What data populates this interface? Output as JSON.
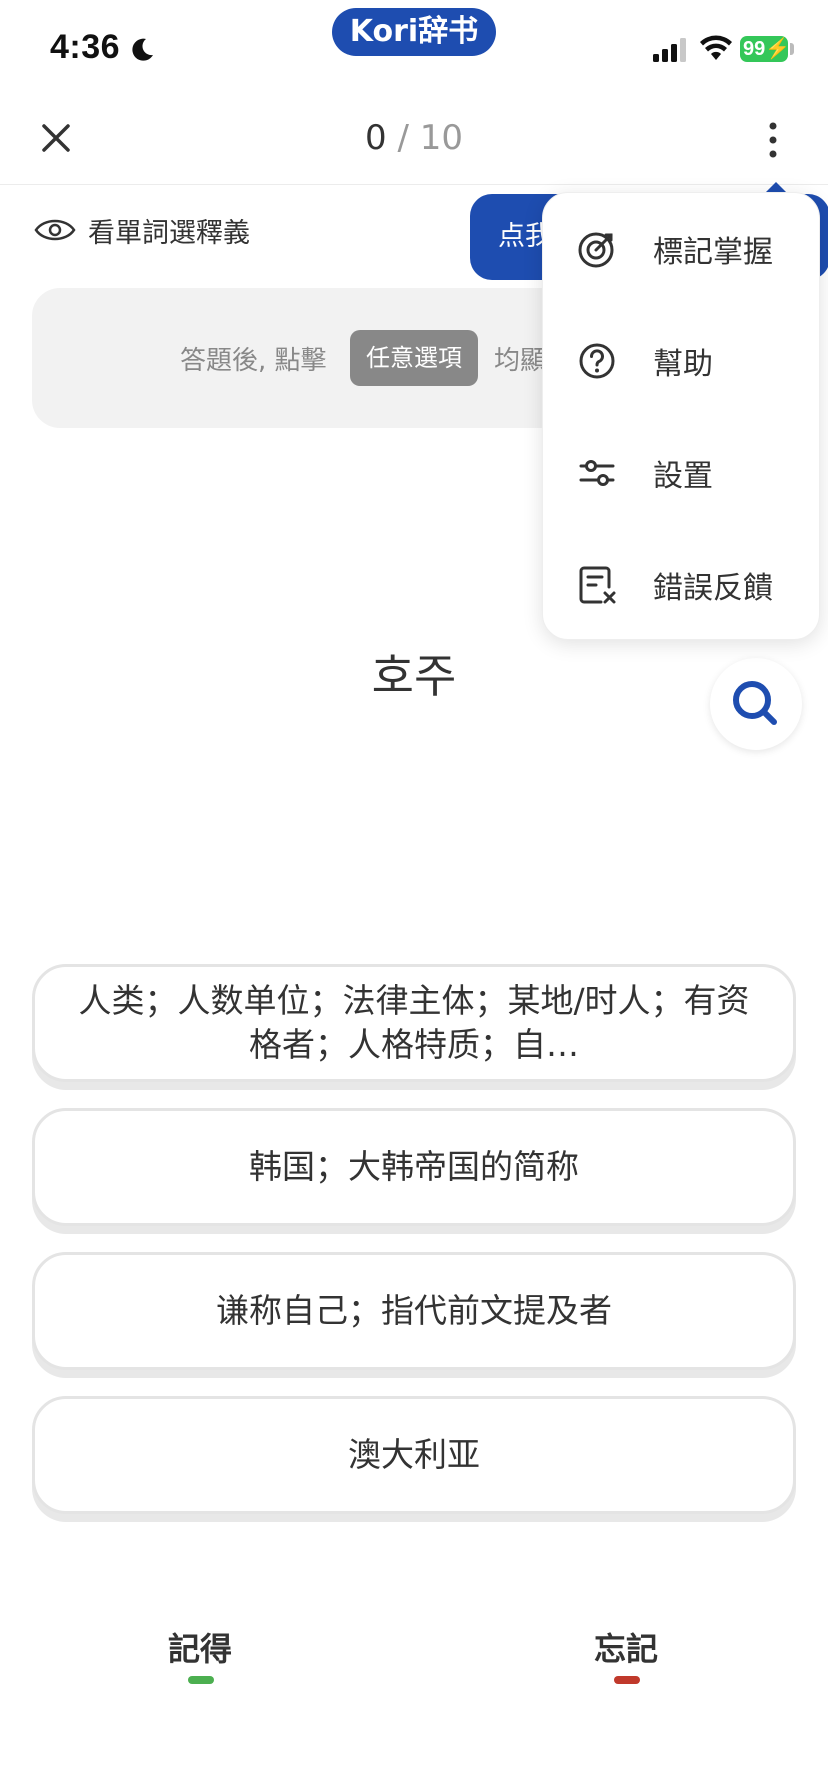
{
  "status_bar": {
    "time": "4:36",
    "brand": "Kori辞书",
    "battery": "99"
  },
  "topbar": {
    "progress_current": "0",
    "progress_total": "10",
    "progress_sep": " / "
  },
  "toggle": {
    "label": "看單詞選釋義"
  },
  "blue_button": {
    "label": "点我"
  },
  "hint": {
    "left": "答題後, 點擊",
    "chip": "任意選項",
    "right": "均顯"
  },
  "word": "호주",
  "options": [
    "人类；人数单位；法律主体；某地/时人；有资格者；人格特质；自…",
    "韩国；大韩帝国的简称",
    "谦称自己；指代前文提及者",
    "澳大利亚"
  ],
  "bottom": {
    "remember": "記得",
    "forget": "忘記"
  },
  "menu": {
    "items": [
      {
        "label": "標記掌握",
        "icon": "target-icon"
      },
      {
        "label": "幫助",
        "icon": "help-icon"
      },
      {
        "label": "設置",
        "icon": "sliders-icon"
      },
      {
        "label": "錯誤反饋",
        "icon": "report-icon"
      }
    ]
  },
  "colors": {
    "brand_blue": "#1E4DB0",
    "remember_green": "#4CAF50",
    "forget_red": "#C0392B"
  }
}
